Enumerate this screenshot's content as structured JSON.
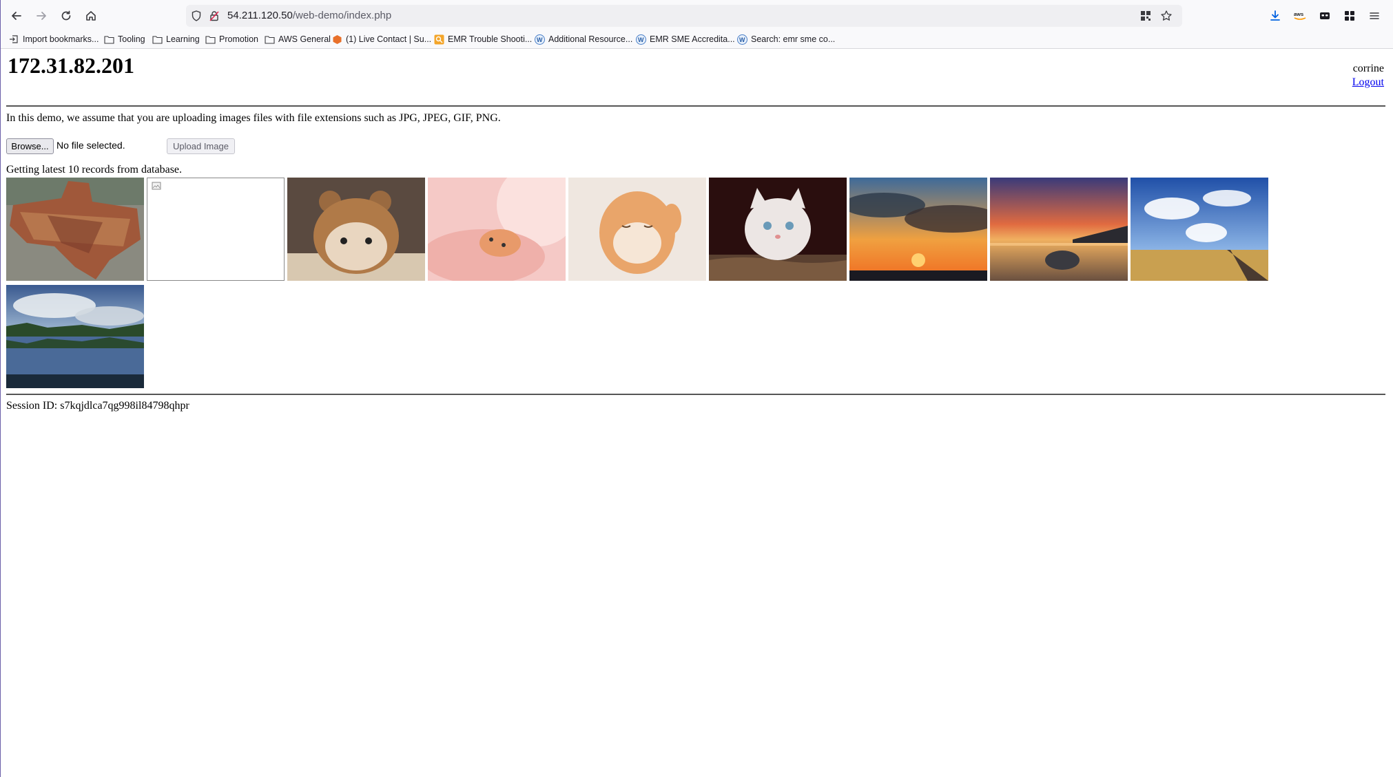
{
  "browser": {
    "url_host": "54.211.120.50",
    "url_path": "/web-demo/index.php",
    "bookmarks": [
      {
        "label": "Import bookmarks...",
        "icon": "import-icon"
      },
      {
        "label": "Tooling",
        "icon": "folder-icon"
      },
      {
        "label": "Learning",
        "icon": "folder-icon"
      },
      {
        "label": "Promotion",
        "icon": "folder-icon"
      },
      {
        "label": "AWS General",
        "icon": "folder-icon"
      },
      {
        "label": "(1) Live Contact | Su...",
        "icon": "hexagon-icon"
      },
      {
        "label": "EMR Trouble Shooti...",
        "icon": "search-site-icon"
      },
      {
        "label": "Additional Resource...",
        "icon": "w-icon"
      },
      {
        "label": "EMR SME Accredita...",
        "icon": "w-icon"
      },
      {
        "label": "Search: emr sme co...",
        "icon": "w-icon"
      }
    ]
  },
  "page": {
    "title": "172.31.82.201",
    "username": "corrine",
    "logout_label": "Logout",
    "intro": "In this demo, we assume that you are uploading images files with file extensions such as JPG, JPEG, GIF, PNG.",
    "browse_label": "Browse...",
    "file_status": "No file selected.",
    "upload_label": "Upload Image",
    "records_text": "Getting latest 10 records from database.",
    "images": [
      {
        "subject": "crowd-texas-map",
        "colors": [
          "#6b4a3a",
          "#b48a6a"
        ]
      },
      {
        "subject": "broken-image",
        "colors": [
          "#ffffff",
          "#ffffff"
        ]
      },
      {
        "subject": "cat-bear-hat",
        "colors": [
          "#c9a27a",
          "#6b5848"
        ]
      },
      {
        "subject": "kitten-pink-blanket",
        "colors": [
          "#f7c7c4",
          "#e89f8f"
        ]
      },
      {
        "subject": "kitten-sleeping",
        "colors": [
          "#f0e6de",
          "#e0a070"
        ]
      },
      {
        "subject": "white-kitten-dark",
        "colors": [
          "#2a1010",
          "#e8e2e0"
        ]
      },
      {
        "subject": "sunset-clouds",
        "colors": [
          "#4a6a90",
          "#e08a30"
        ]
      },
      {
        "subject": "beach-sunset",
        "colors": [
          "#3a3a6a",
          "#e8a060"
        ]
      },
      {
        "subject": "road-blue-sky",
        "colors": [
          "#2a5ab0",
          "#c9a050"
        ]
      },
      {
        "subject": "lake-reflection",
        "colors": [
          "#5a7aa8",
          "#2a4a30"
        ]
      }
    ],
    "session_text": "Session ID: s7kqjdlca7qg998il84798qhpr"
  }
}
